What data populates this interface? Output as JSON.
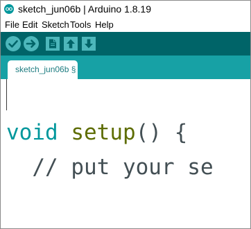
{
  "window": {
    "title": "sketch_jun06b | Arduino 1.8.19"
  },
  "menubar": {
    "items": [
      {
        "label": "File"
      },
      {
        "label": "Edit"
      },
      {
        "label": "Sketch"
      },
      {
        "label": "Tools"
      },
      {
        "label": "Help"
      }
    ]
  },
  "toolbar": {
    "buttons": [
      {
        "icon": "checkmark-icon",
        "action": "verify"
      },
      {
        "icon": "arrow-right-icon",
        "action": "upload"
      },
      {
        "icon": "new-file-icon",
        "action": "new"
      },
      {
        "icon": "arrow-up-icon",
        "action": "open"
      },
      {
        "icon": "arrow-down-icon",
        "action": "save"
      }
    ]
  },
  "tabs": [
    {
      "label": "sketch_jun06b §"
    }
  ],
  "editor": {
    "lines": [
      {
        "type_keyword": "void",
        "function_name": "setup",
        "rest": "() {"
      },
      {
        "comment": "  // put your se"
      }
    ]
  },
  "colors": {
    "toolbar_bg": "#006468",
    "tabbar_bg": "#17a1a5",
    "keyword_type": "#00979c",
    "keyword_function": "#5e6d03",
    "text": "#434f54"
  }
}
